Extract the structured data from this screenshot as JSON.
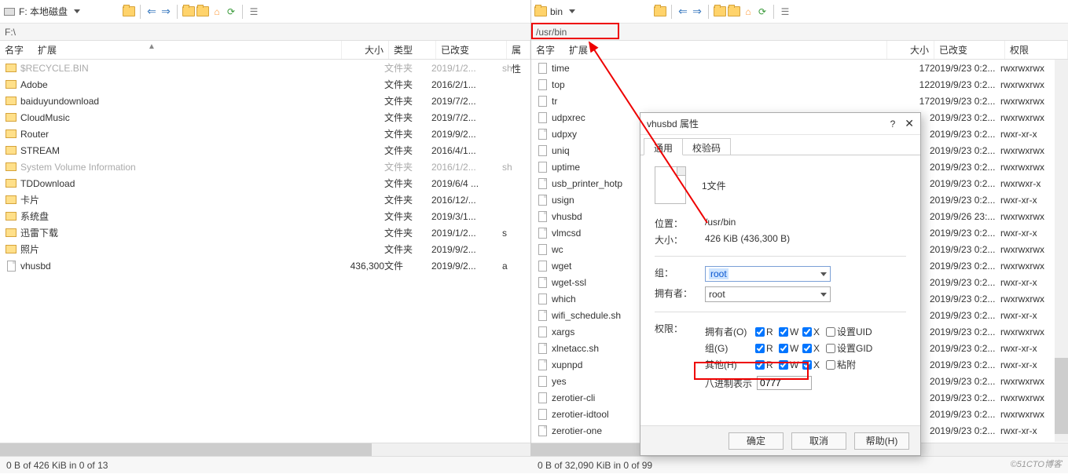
{
  "left": {
    "drive_label": "F: 本地磁盘",
    "path": "F:\\",
    "headers": {
      "name": "名字",
      "ext": "扩展",
      "size": "大小",
      "type": "类型",
      "changed": "已改变",
      "attr": "属性"
    },
    "rows": [
      {
        "icon": "dir",
        "name": "$RECYCLE.BIN",
        "grey": true,
        "size": "",
        "type": "文件夹",
        "date": "2019/1/2...",
        "attr": "sh"
      },
      {
        "icon": "dir",
        "name": "Adobe",
        "size": "",
        "type": "文件夹",
        "date": "2016/2/1...",
        "attr": ""
      },
      {
        "icon": "dir",
        "name": "baiduyundownload",
        "size": "",
        "type": "文件夹",
        "date": "2019/7/2...",
        "attr": ""
      },
      {
        "icon": "dir",
        "name": "CloudMusic",
        "size": "",
        "type": "文件夹",
        "date": "2019/7/2...",
        "attr": ""
      },
      {
        "icon": "dir",
        "name": "Router",
        "size": "",
        "type": "文件夹",
        "date": "2019/9/2...",
        "attr": ""
      },
      {
        "icon": "dir",
        "name": "STREAM",
        "size": "",
        "type": "文件夹",
        "date": "2016/4/1...",
        "attr": ""
      },
      {
        "icon": "dir",
        "name": "System Volume Information",
        "grey": true,
        "size": "",
        "type": "文件夹",
        "date": "2016/1/2...",
        "attr": "sh"
      },
      {
        "icon": "dir",
        "name": "TDDownload",
        "size": "",
        "type": "文件夹",
        "date": "2019/6/4 ...",
        "attr": ""
      },
      {
        "icon": "dir",
        "name": "卡片",
        "size": "",
        "type": "文件夹",
        "date": "2016/12/...",
        "attr": ""
      },
      {
        "icon": "dir",
        "name": "系统盘",
        "size": "",
        "type": "文件夹",
        "date": "2019/3/1...",
        "attr": ""
      },
      {
        "icon": "dir",
        "name": "迅雷下载",
        "size": "",
        "type": "文件夹",
        "date": "2019/1/2...",
        "attr": "s"
      },
      {
        "icon": "dir",
        "name": "照片",
        "size": "",
        "type": "文件夹",
        "date": "2019/9/2...",
        "attr": ""
      },
      {
        "icon": "file",
        "name": "vhusbd",
        "size": "436,300",
        "type": "文件",
        "date": "2019/9/2...",
        "attr": "a"
      }
    ],
    "status": "0 B of 426 KiB in 0 of 13"
  },
  "right": {
    "drive_label": "bin",
    "path": "/usr/bin",
    "headers": {
      "name": "名字",
      "ext": "扩展",
      "size": "大小",
      "changed": "已改变",
      "perm": "权限"
    },
    "rows": [
      {
        "icon": "link",
        "name": "time",
        "size": "17",
        "date": "2019/9/23 0:2...",
        "perm": "rwxrwxrwx"
      },
      {
        "icon": "link",
        "name": "top",
        "size": "12",
        "date": "2019/9/23 0:2...",
        "perm": "rwxrwxrwx"
      },
      {
        "icon": "link",
        "name": "tr",
        "size": "17",
        "date": "2019/9/23 0:2...",
        "perm": "rwxrwxrwx"
      },
      {
        "icon": "link",
        "name": "udpxrec",
        "size": "",
        "date": "2019/9/23 0:2...",
        "perm": "rwxrwxrwx"
      },
      {
        "icon": "file",
        "name": "udpxy",
        "size": "",
        "date": "2019/9/23 0:2...",
        "perm": "rwxr-xr-x"
      },
      {
        "icon": "link",
        "name": "uniq",
        "size": "",
        "date": "2019/9/23 0:2...",
        "perm": "rwxrwxrwx"
      },
      {
        "icon": "link",
        "name": "uptime",
        "size": "",
        "date": "2019/9/23 0:2...",
        "perm": "rwxrwxrwx"
      },
      {
        "icon": "file",
        "name": "usb_printer_hotp",
        "size": "",
        "date": "2019/9/23 0:2...",
        "perm": "rwxrwxr-x"
      },
      {
        "icon": "file",
        "name": "usign",
        "size": "",
        "date": "2019/9/23 0:2...",
        "perm": "rwxr-xr-x"
      },
      {
        "icon": "file",
        "name": "vhusbd",
        "size": "",
        "date": "2019/9/26 23:...",
        "perm": "rwxrwxrwx"
      },
      {
        "icon": "file",
        "name": "vlmcsd",
        "size": "",
        "date": "2019/9/23 0:2...",
        "perm": "rwxr-xr-x"
      },
      {
        "icon": "link",
        "name": "wc",
        "size": "",
        "date": "2019/9/23 0:2...",
        "perm": "rwxrwxrwx"
      },
      {
        "icon": "link",
        "name": "wget",
        "size": "",
        "date": "2019/9/23 0:2...",
        "perm": "rwxrwxrwx"
      },
      {
        "icon": "file",
        "name": "wget-ssl",
        "size": "",
        "date": "2019/9/23 0:2...",
        "perm": "rwxr-xr-x"
      },
      {
        "icon": "link",
        "name": "which",
        "size": "",
        "date": "2019/9/23 0:2...",
        "perm": "rwxrwxrwx"
      },
      {
        "icon": "file",
        "name": "wifi_schedule.sh",
        "size": "",
        "date": "2019/9/23 0:2...",
        "perm": "rwxr-xr-x"
      },
      {
        "icon": "link",
        "name": "xargs",
        "size": "",
        "date": "2019/9/23 0:2...",
        "perm": "rwxrwxrwx"
      },
      {
        "icon": "file",
        "name": "xlnetacc.sh",
        "size": "",
        "date": "2019/9/23 0:2...",
        "perm": "rwxr-xr-x"
      },
      {
        "icon": "file",
        "name": "xupnpd",
        "size": "",
        "date": "2019/9/23 0:2...",
        "perm": "rwxr-xr-x"
      },
      {
        "icon": "link",
        "name": "yes",
        "size": "",
        "date": "2019/9/23 0:2...",
        "perm": "rwxrwxrwx"
      },
      {
        "icon": "link",
        "name": "zerotier-cli",
        "size": "",
        "date": "2019/9/23 0:2...",
        "perm": "rwxrwxrwx"
      },
      {
        "icon": "link",
        "name": "zerotier-idtool",
        "size": "",
        "date": "2019/9/23 0:2...",
        "perm": "rwxrwxrwx"
      },
      {
        "icon": "file",
        "name": "zerotier-one",
        "size": "",
        "date": "2019/9/23 0:2...",
        "perm": "rwxr-xr-x"
      }
    ],
    "status": "0 B of 32,090 KiB in 0 of 99"
  },
  "dialog": {
    "title": "vhusbd 属性",
    "tabs": {
      "general": "通用",
      "checksum": "校验码"
    },
    "file_count": "1文件",
    "location_k": "位置：",
    "location_v": "/usr/bin",
    "size_k": "大小：",
    "size_v": "426 KiB (436,300 B)",
    "group_k": "组：",
    "group_v": "root",
    "owner_k": "拥有者：",
    "owner_v": "root",
    "perm_k": "权限：",
    "perm_owner": "拥有者(O)",
    "perm_group": "组(G)",
    "perm_other": "其他(H)",
    "r": "R",
    "w": "W",
    "x": "X",
    "setuid": "设置UID",
    "setgid": "设置GID",
    "sticky": "粘附",
    "octal_k": "八进制表示",
    "octal_v": "0777",
    "ok": "确定",
    "cancel": "取消",
    "help": "帮助(H)"
  },
  "watermark": "©51CTO博客"
}
